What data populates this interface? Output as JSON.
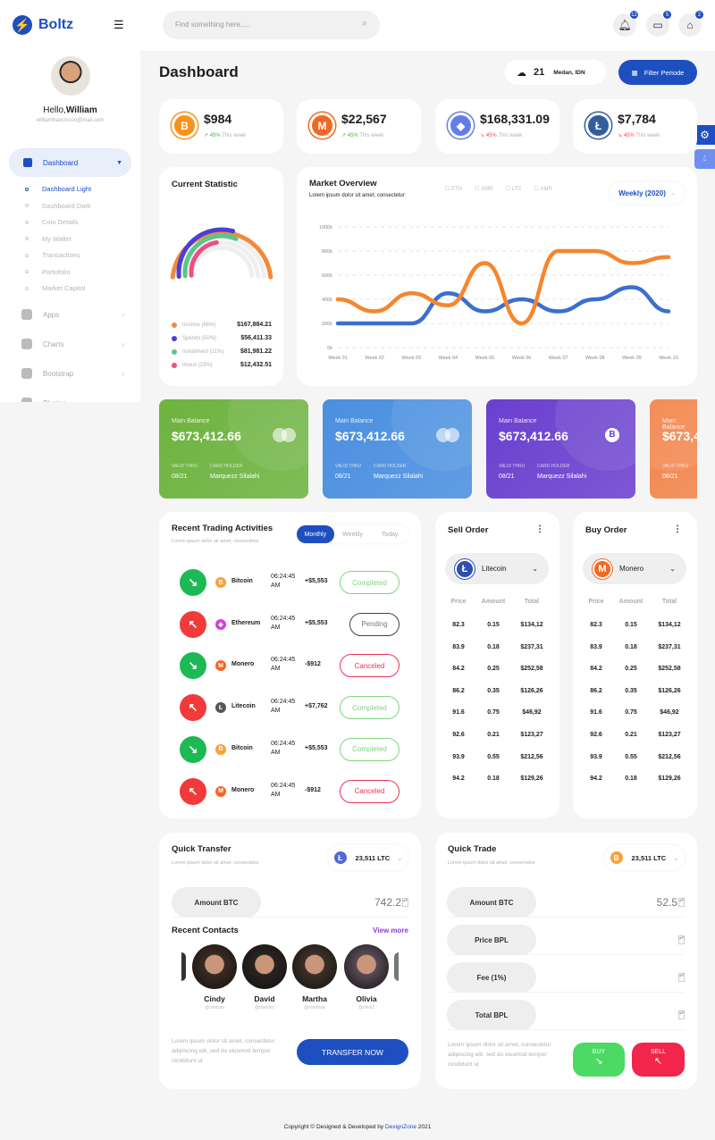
{
  "app": {
    "name": "Boltz",
    "page_title": "Dashboard"
  },
  "header": {
    "search_placeholder": "Find something here.....",
    "notifications": [
      {
        "icon": "bell-icon",
        "count": "12"
      },
      {
        "icon": "chat-icon",
        "count": "5"
      },
      {
        "icon": "gift-icon",
        "count": "2"
      }
    ]
  },
  "user": {
    "greeting": "Hello,",
    "name": "William",
    "email": "williamfrancisson@mail.com"
  },
  "sidebar": {
    "active": "Dashboard",
    "sub_items": [
      "Dashboard Light",
      "Dashboard Dark",
      "Coin Details",
      "My Wallet",
      "Transactions",
      "Portofolio",
      "Market Capitol"
    ],
    "items": [
      "Apps",
      "Charts",
      "Bootstrap",
      "Plugins"
    ]
  },
  "weather": {
    "temp": "21",
    "location": "Medan, IDN"
  },
  "filter_button": "Filter Periode",
  "stats": [
    {
      "coin": "Bitcoin",
      "symbol": "B",
      "color": "#f7931a",
      "value": "$984",
      "change": "45%",
      "trend": "up",
      "period": "This week"
    },
    {
      "coin": "Monero",
      "symbol": "M",
      "color": "#f26822",
      "value": "$22,567",
      "change": "45%",
      "trend": "up",
      "period": "This week"
    },
    {
      "coin": "Ethereum",
      "symbol": "◆",
      "color": "#627eea",
      "value": "$168,331.09",
      "change": "45%",
      "trend": "down",
      "period": "This week"
    },
    {
      "coin": "Litecoin",
      "symbol": "Ł",
      "color": "#345d9d",
      "value": "$7,784",
      "change": "45%",
      "trend": "down",
      "period": "This week"
    }
  ],
  "current_statistic": {
    "title": "Current Statistic",
    "items": [
      {
        "label": "Income (66%)",
        "value": "$167,884.21",
        "color": "#f5893b",
        "fill": 1.0
      },
      {
        "label": "Spends (50%)",
        "value": "$56,411.33",
        "color": "#4a3fd6",
        "fill": 0.58
      },
      {
        "label": "Installment (11%)",
        "value": "$81,981.22",
        "color": "#5cc58a",
        "fill": 0.62
      },
      {
        "label": "Invest (23%)",
        "value": "$12,432.51",
        "color": "#ee4f7f",
        "fill": 0.45
      }
    ]
  },
  "chart_data": {
    "type": "line",
    "title": "Market Overview",
    "subtitle": "Lorem ipsum dolor sit amet, consectetur",
    "legend": [
      "ETH",
      "XMR",
      "LTC",
      "XMR"
    ],
    "period_select": "Weekly (2020)",
    "categories": [
      "Week 01",
      "Week 02",
      "Week 03",
      "Week 04",
      "Week 05",
      "Week 06",
      "Week 07",
      "Week 08",
      "Week 09",
      "Week 10"
    ],
    "y_ticks": [
      "0k",
      "200k",
      "400k",
      "600k",
      "800k",
      "1000k"
    ],
    "ylim": [
      0,
      1000
    ],
    "grid": true,
    "series": [
      {
        "color": "#f5862f",
        "values": [
          400,
          300,
          450,
          350,
          700,
          200,
          800,
          800,
          700,
          750
        ]
      },
      {
        "color": "#3b6fcf",
        "values": [
          200,
          200,
          200,
          450,
          300,
          400,
          300,
          400,
          500,
          300
        ]
      }
    ]
  },
  "balance_cards": [
    {
      "label": "Main Balance",
      "amount": "$673,412.66",
      "valid_label": "VALID THRU",
      "valid": "08/21",
      "holder_label": "CARD HOLDER",
      "holder": "Marquezz Silalahi",
      "color": "#6db33f",
      "icon": "mastercard-icon"
    },
    {
      "label": "Main Balance",
      "amount": "$673,412.66",
      "valid_label": "VALID THRU",
      "valid": "08/21",
      "holder_label": "CARD HOLDER",
      "holder": "Marquezz Silalahi",
      "color": "#4a8fe0",
      "icon": "mastercard-icon"
    },
    {
      "label": "Main Balance",
      "amount": "$673,412.66",
      "valid_label": "VALID THRU",
      "valid": "08/21",
      "holder_label": "CARD HOLDER",
      "holder": "Marquezz Silalahi",
      "color": "#6a3fcf",
      "icon": "bitcoin-icon"
    },
    {
      "label": "Main Balance",
      "amount": "$673,412.66",
      "valid_label": "VALID THRU",
      "valid": "08/21",
      "holder_label": "CARD HOLDER",
      "holder": "Marquezz Silalahi",
      "color": "#f2844a",
      "icon": "mastercard-icon"
    }
  ],
  "trading": {
    "title": "Recent Trading Activities",
    "subtitle": "Lorem ipsum dolor sit amet, consectetur",
    "tabs": [
      "Monthly",
      "Weekly",
      "Today"
    ],
    "active_tab": "Monthly",
    "rows": [
      {
        "dir": "down",
        "coin": "Bitcoin",
        "coin_color": "#f7a33a",
        "sym": "B",
        "time": "06:24:45",
        "ampm": "AM",
        "amount": "+$5,553",
        "status": "Completed"
      },
      {
        "dir": "up",
        "coin": "Ethereum",
        "coin_color": "#d43fd6",
        "sym": "◆",
        "time": "06:24:45",
        "ampm": "AM",
        "amount": "+$5,553",
        "status": "Pending"
      },
      {
        "dir": "down",
        "coin": "Monero",
        "coin_color": "#f26822",
        "sym": "M",
        "time": "06:24:45",
        "ampm": "AM",
        "amount": "-$912",
        "status": "Canceled"
      },
      {
        "dir": "up",
        "coin": "Litecoin",
        "coin_color": "#555",
        "sym": "Ł",
        "time": "06:24:45",
        "ampm": "AM",
        "amount": "+$7,762",
        "status": "Completed"
      },
      {
        "dir": "down",
        "coin": "Bitcoin",
        "coin_color": "#f7a33a",
        "sym": "B",
        "time": "06:24:45",
        "ampm": "AM",
        "amount": "+$5,553",
        "status": "Completed"
      },
      {
        "dir": "up",
        "coin": "Monero",
        "coin_color": "#f26822",
        "sym": "M",
        "time": "06:24:45",
        "ampm": "AM",
        "amount": "-$912",
        "status": "Canceled"
      }
    ]
  },
  "orders": [
    {
      "title": "Sell Order",
      "coin": "Litecoin",
      "sym": "Ł",
      "color": "#2f4fb0",
      "headers": [
        "Price",
        "Amount",
        "Total"
      ],
      "rows": [
        [
          "82.3",
          "0.15",
          "$134,12"
        ],
        [
          "83.9",
          "0.18",
          "$237,31"
        ],
        [
          "84.2",
          "0.25",
          "$252,58"
        ],
        [
          "86.2",
          "0.35",
          "$126,26"
        ],
        [
          "91.6",
          "0.75",
          "$46,92"
        ],
        [
          "92.6",
          "0.21",
          "$123,27"
        ],
        [
          "93.9",
          "0.55",
          "$212,56"
        ],
        [
          "94.2",
          "0.18",
          "$129,26"
        ]
      ]
    },
    {
      "title": "Buy Order",
      "coin": "Monero",
      "sym": "M",
      "color": "#f26822",
      "headers": [
        "Price",
        "Amount",
        "Total"
      ],
      "rows": [
        [
          "82.3",
          "0.15",
          "$134,12"
        ],
        [
          "83.9",
          "0.18",
          "$237,31"
        ],
        [
          "84.2",
          "0.25",
          "$252,58"
        ],
        [
          "86.2",
          "0.35",
          "$126,26"
        ],
        [
          "91.6",
          "0.75",
          "$46,92"
        ],
        [
          "92.6",
          "0.21",
          "$123,27"
        ],
        [
          "93.9",
          "0.55",
          "$212,56"
        ],
        [
          "94.2",
          "0.18",
          "$129,26"
        ]
      ]
    }
  ],
  "quick_transfer": {
    "title": "Quick Transfer",
    "subtitle": "Lorem ipsum dolor sit amet, consectetur",
    "balance": "23,511 LTC",
    "amount_label": "Amount BTC",
    "amount_value": "742.2",
    "contacts_title": "Recent Contacts",
    "view_more": "View more",
    "contacts": [
      {
        "name": "Cindy",
        "handle": "@cindyss"
      },
      {
        "name": "David",
        "handle": "@davidxc"
      },
      {
        "name": "Martha",
        "handle": "@marthaa"
      },
      {
        "name": "Olivia",
        "handle": "@oliv62"
      }
    ],
    "note": "Lorem ipsum dolor sit amet, consectetur adipiscing elit, sed do eiusmod tempor incididunt ut",
    "button": "TRANSFER NOW"
  },
  "quick_trade": {
    "title": "Quick Trade",
    "subtitle": "Lorem ipsum dolor sit amet, consectetur",
    "balance": "23,511 LTC",
    "fields": [
      {
        "label": "Amount BTC",
        "value": "52.5"
      },
      {
        "label": "Price BPL",
        "value": ""
      },
      {
        "label": "Fee (1%)",
        "value": ""
      },
      {
        "label": "Total BPL",
        "value": ""
      }
    ],
    "note": "Lorem ipsum dolor sit amet, consectetur adipiscing elit, sed do eiusmod tempor incididunt ut",
    "buy": "BUY",
    "sell": "SELL"
  },
  "footer": {
    "text": "Copyright © Designed & Developed by",
    "brand": "DexignZone",
    "year": "2021"
  },
  "colors": {
    "primary": "#1e4fc0",
    "success": "#1db954",
    "danger": "#f23a3a"
  }
}
